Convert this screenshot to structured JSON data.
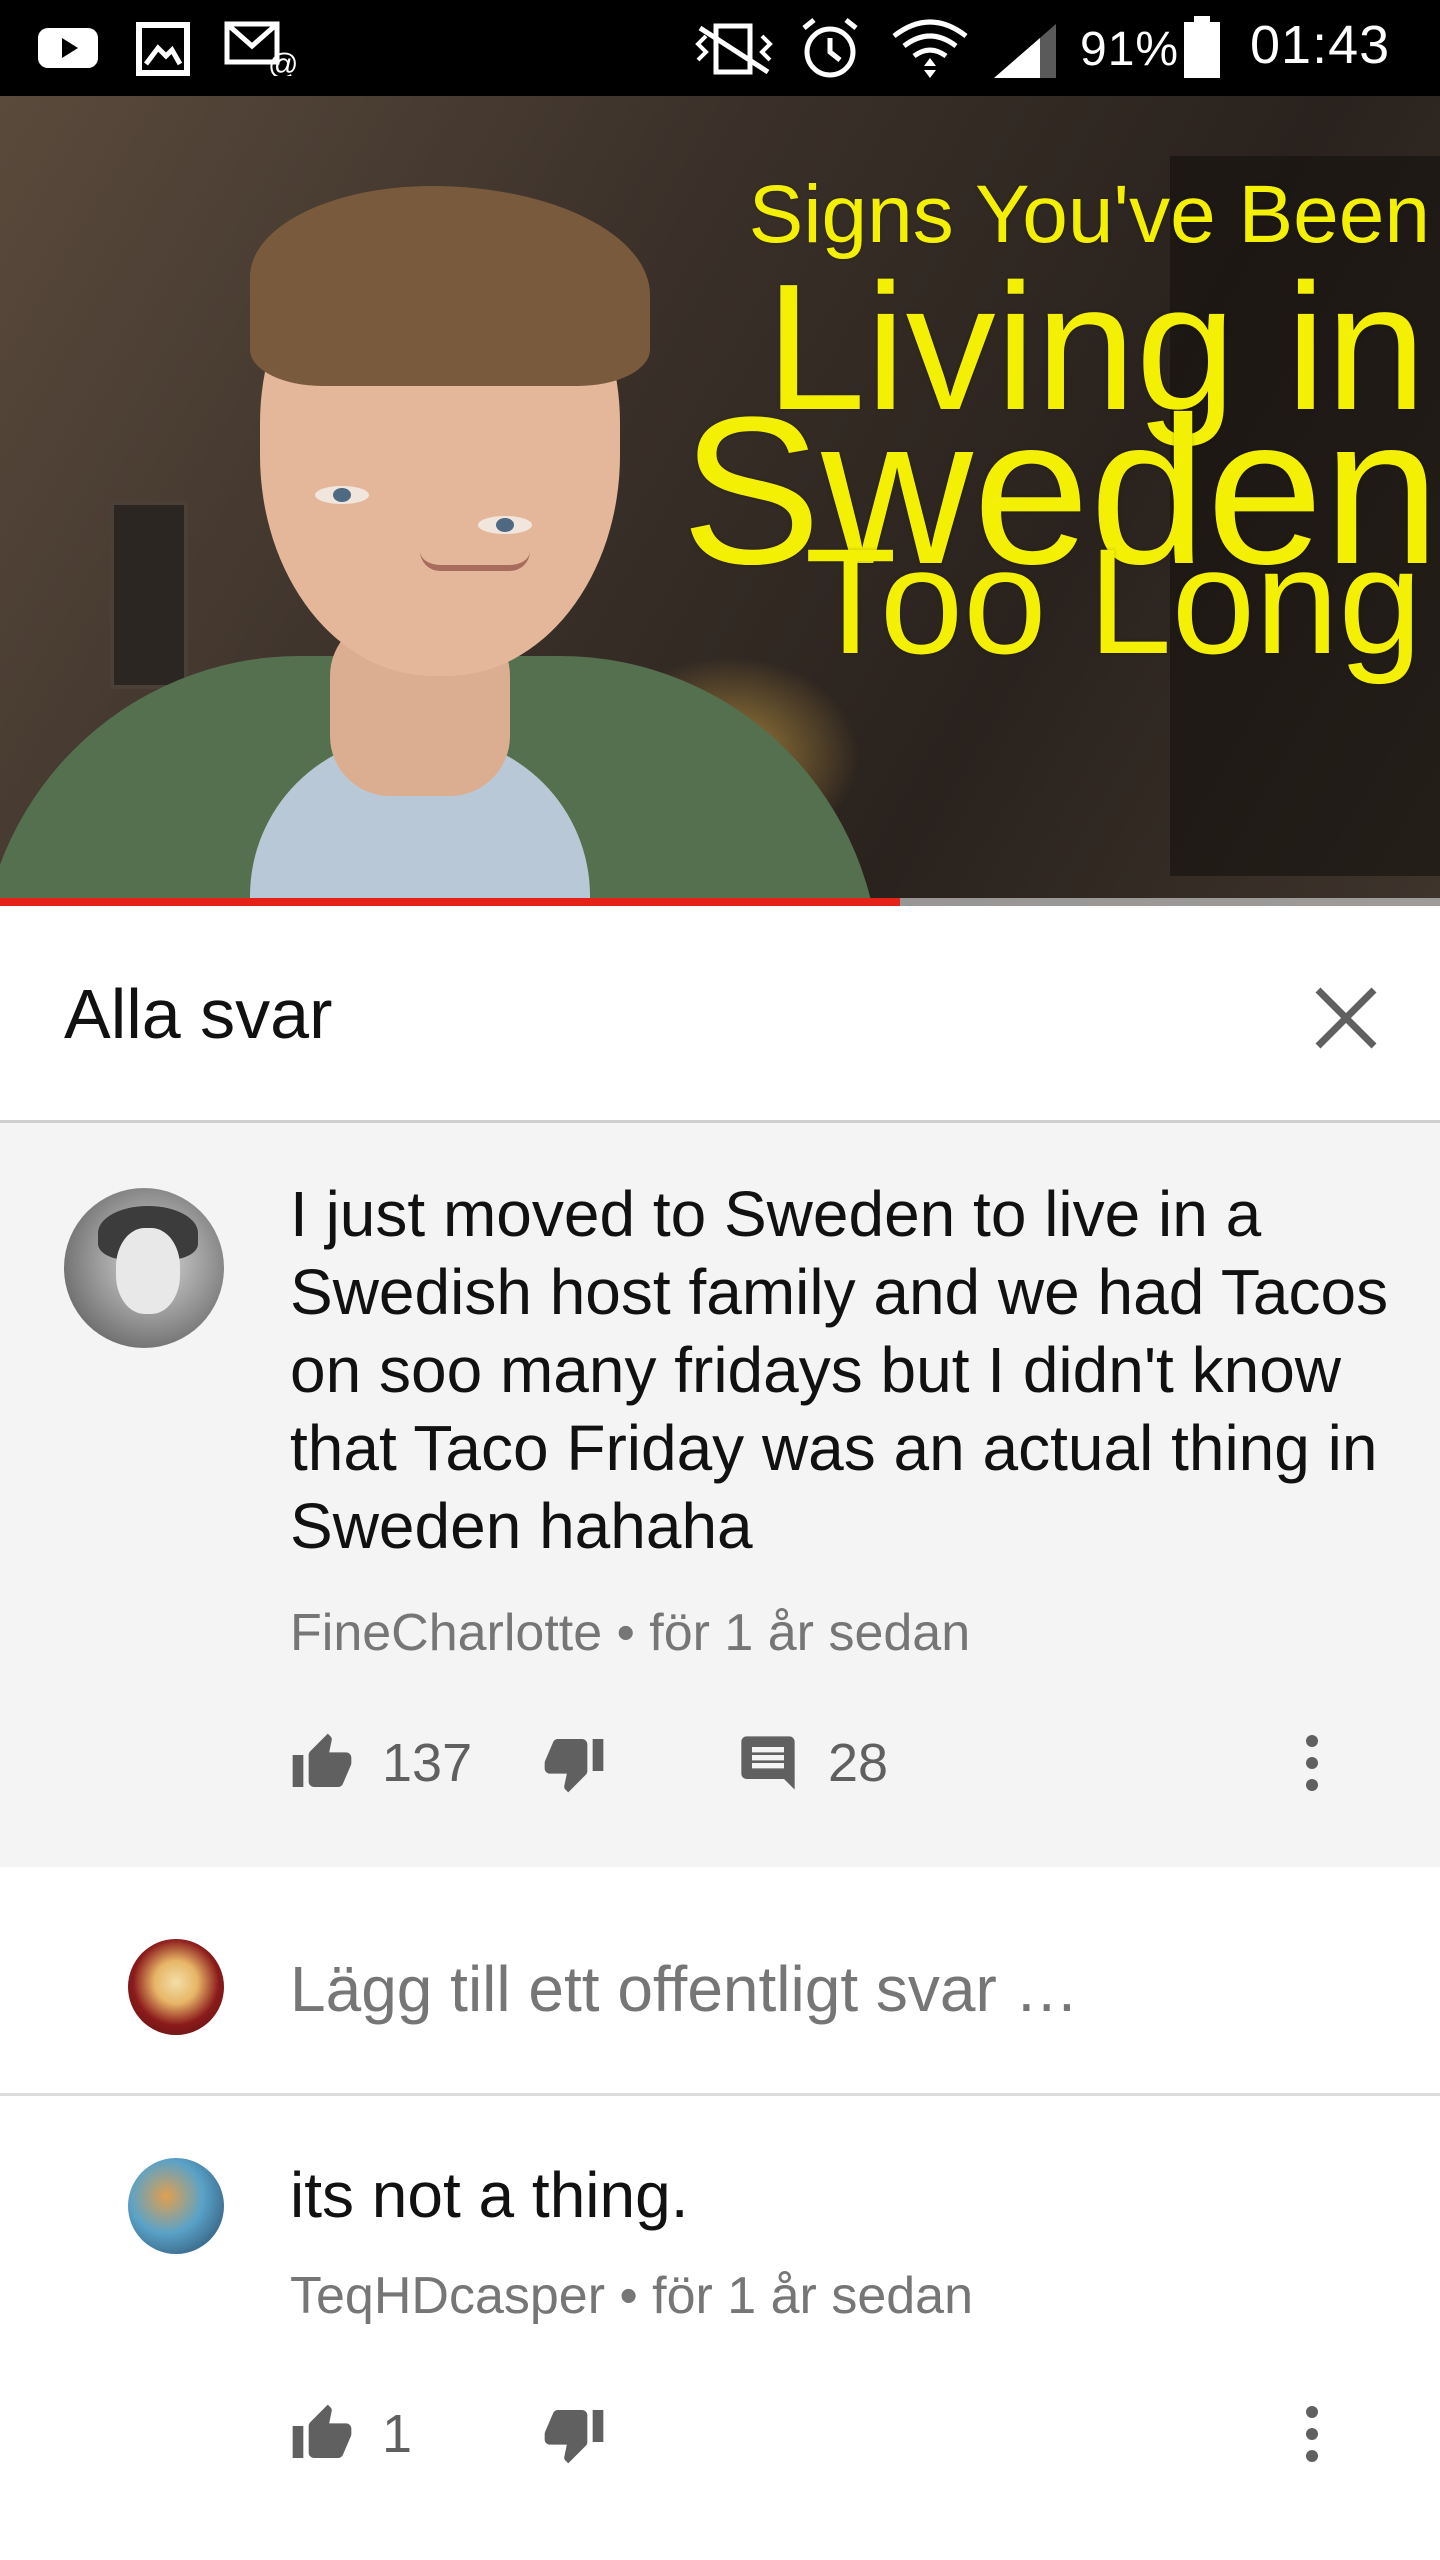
{
  "status_bar": {
    "battery_percent": "91%",
    "time": "01:43"
  },
  "video": {
    "title_line1": "Signs You've Been",
    "title_line2": "Living in",
    "title_line3": "Sweden",
    "title_line4": "Too Long",
    "progress_fraction": 0.625
  },
  "header": {
    "title": "Alla svar"
  },
  "comment": {
    "text": "I just moved to Sweden to live in a Swedish host family and we had Tacos on soo many fridays but I didn't know that Taco Friday was an actual thing in Sweden hahaha",
    "author": "FineCharlotte",
    "separator": " • ",
    "time": "för 1 år sedan",
    "likes": "137",
    "replies": "28"
  },
  "reply_input": {
    "placeholder": "Lägg till ett offentligt svar …"
  },
  "reply": {
    "text": "its not a thing.",
    "author": "TeqHDcasper",
    "separator": " • ",
    "time": "för 1 år sedan",
    "likes": "1"
  },
  "colors": {
    "progress": "#e62117",
    "video_title": "#f4f004",
    "meta_text": "#767676"
  }
}
